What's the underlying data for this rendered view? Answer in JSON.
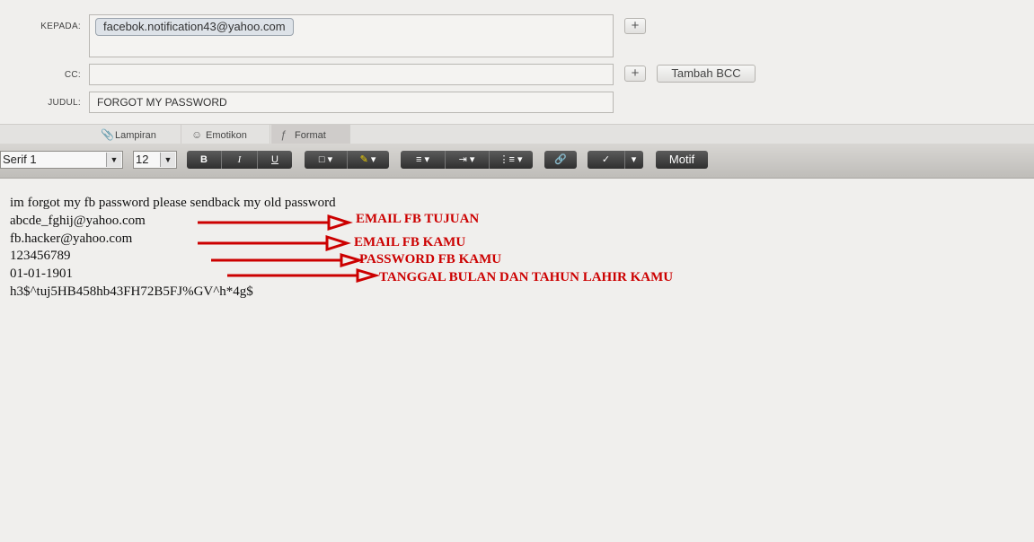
{
  "header": {
    "to_label": "KEPADA:",
    "to_value": "facebok.notification43@yahoo.com",
    "cc_label": "CC:",
    "cc_value": "",
    "subject_label": "JUDUL:",
    "subject_value": "FORGOT MY PASSWORD",
    "add_symbol": "+",
    "bcc_button": "Tambah BCC"
  },
  "tabs": [
    {
      "label": "Lampiran",
      "icon": "paperclip-icon"
    },
    {
      "label": "Emotikon",
      "icon": "smiley-icon"
    },
    {
      "label": "Format",
      "icon": "format-icon",
      "active": true
    }
  ],
  "toolbar": {
    "font_family": "Serif 1",
    "font_size": "12",
    "bold": "B",
    "italic": "I",
    "underline": "U",
    "motif_button": "Motif"
  },
  "body": {
    "lines": [
      "im forgot my fb password please sendback my old password",
      "abcde_fghij@yahoo.com",
      "fb.hacker@yahoo.com",
      "123456789",
      "01-01-1901",
      "h3$^tuj5HB458hb43FH72B5FJ%GV^h*4g$"
    ],
    "annotations": [
      "EMAIL FB TUJUAN",
      "EMAIL FB KAMU",
      "PASSWORD FB KAMU",
      "TANGGAL BULAN DAN TAHUN LAHIR KAMU"
    ]
  },
  "colors": {
    "annotation": "#cc0000",
    "toolbar_button": "#3a3a3a"
  }
}
